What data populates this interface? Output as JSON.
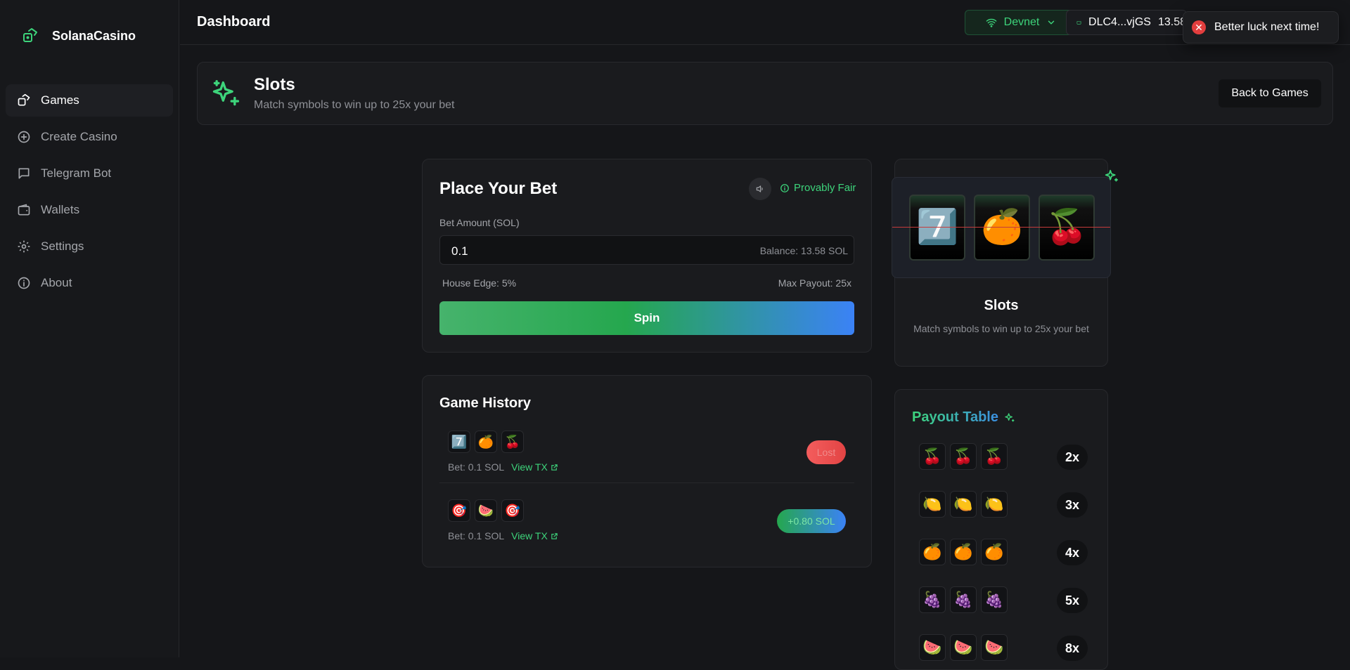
{
  "app": {
    "name": "SolanaCasino"
  },
  "sidebar": {
    "items": [
      {
        "label": "Games",
        "icon": "games-icon"
      },
      {
        "label": "Create Casino",
        "icon": "plus-circle-icon"
      },
      {
        "label": "Telegram Bot",
        "icon": "chat-icon"
      },
      {
        "label": "Wallets",
        "icon": "wallet-icon"
      },
      {
        "label": "Settings",
        "icon": "gear-icon"
      },
      {
        "label": "About",
        "icon": "info-icon"
      }
    ]
  },
  "topbar": {
    "title": "Dashboard",
    "network": "Devnet",
    "wallet_address": "DLC4...vjGS",
    "wallet_balance": "13.58"
  },
  "toast": {
    "message": "Better luck next time!"
  },
  "game": {
    "title": "Slots",
    "subtitle": "Match symbols to win up to 25x your bet",
    "back_label": "Back to Games"
  },
  "bet": {
    "title": "Place Your Bet",
    "provably_fair": "Provably Fair",
    "amount_label": "Bet Amount (SOL)",
    "amount_value": "0.1",
    "balance": "Balance: 13.58 SOL",
    "house_edge": "House Edge: 5%",
    "max_payout": "Max Payout: 25x",
    "spin_label": "Spin"
  },
  "history": {
    "title": "Game History",
    "rows": [
      {
        "symbols": [
          "7️⃣",
          "🍊",
          "🍒"
        ],
        "bet": "Bet: 0.1 SOL",
        "tx": "View TX",
        "result": "Lost"
      },
      {
        "symbols": [
          "🎯",
          "🍉",
          "🎯"
        ],
        "bet": "Bet: 0.1 SOL",
        "tx": "View TX",
        "result": "+0.80 SOL"
      }
    ]
  },
  "reels": {
    "symbols": [
      "7️⃣",
      "🍊",
      "🍒"
    ]
  },
  "slot_info": {
    "title": "Slots",
    "description": "Match symbols to win up to 25x your bet"
  },
  "payout": {
    "title": "Payout Table",
    "rows": [
      {
        "symbol": "🍒",
        "mult": "2x"
      },
      {
        "symbol": "🍋",
        "mult": "3x"
      },
      {
        "symbol": "🍊",
        "mult": "4x"
      },
      {
        "symbol": "🍇",
        "mult": "5x"
      },
      {
        "symbol": "🍉",
        "mult": "8x"
      }
    ]
  },
  "colors": {
    "accent": "#3dd47b",
    "blue": "#3b82f6",
    "danger": "#e24444",
    "bg": "#151619"
  }
}
